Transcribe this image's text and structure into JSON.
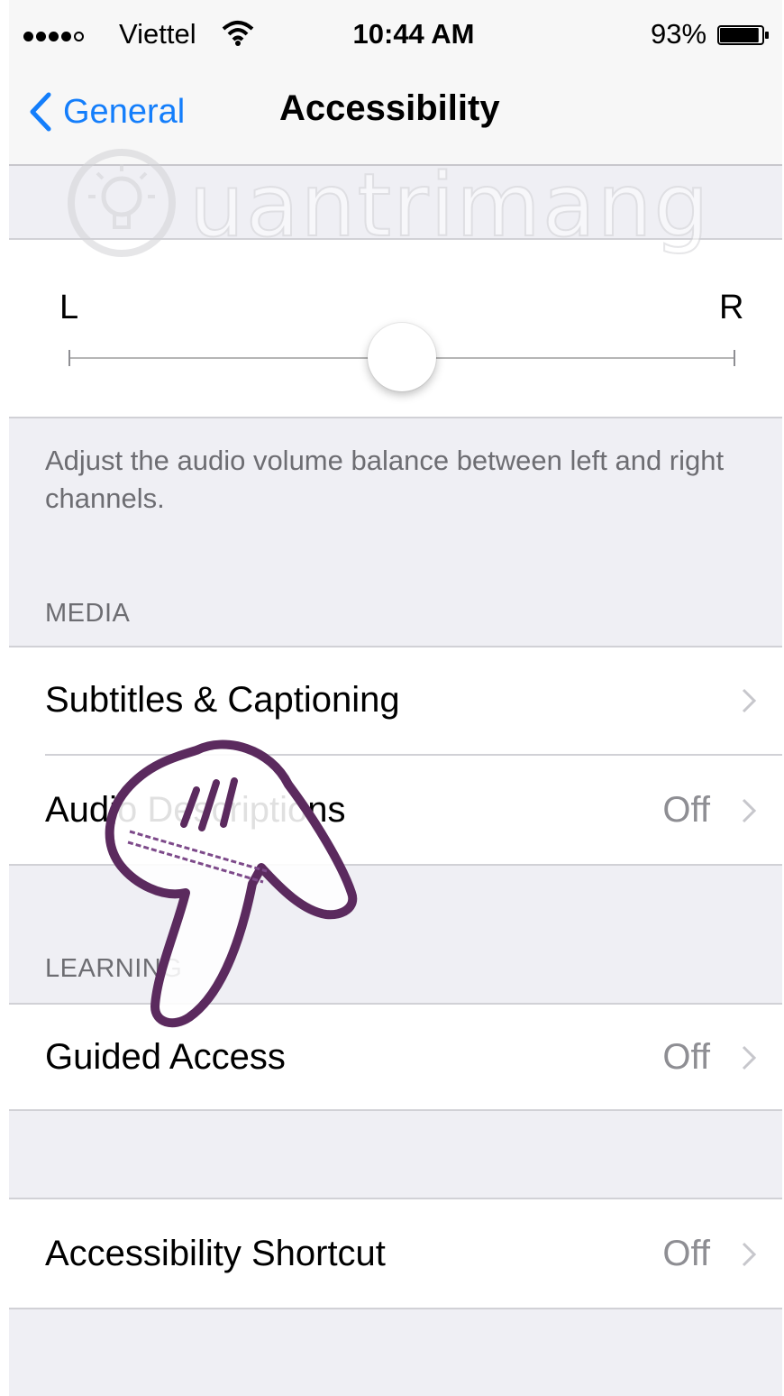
{
  "status_bar": {
    "carrier": "Viettel",
    "time": "10:44 AM",
    "battery_percent": "93%",
    "battery_level": 0.93,
    "signal_bars": 4,
    "icons": [
      "signal-dots-icon",
      "wifi-icon",
      "battery-icon"
    ]
  },
  "nav": {
    "back_label": "General",
    "title": "Accessibility",
    "back_icon": "chevron-left-icon"
  },
  "balance": {
    "left_label": "L",
    "right_label": "R",
    "value": 0.5,
    "footer": "Adjust the audio volume balance between left and right channels."
  },
  "media_section": {
    "header": "MEDIA",
    "items": [
      {
        "label": "Subtitles & Captioning",
        "value": ""
      },
      {
        "label": "Audio Descriptions",
        "value": "Off"
      }
    ]
  },
  "learning_section": {
    "header": "LEARNING",
    "items": [
      {
        "label": "Guided Access",
        "value": "Off"
      }
    ]
  },
  "shortcut_section": {
    "items": [
      {
        "label": "Accessibility Shortcut",
        "value": "Off"
      }
    ]
  },
  "watermark": {
    "text": "uantrimang",
    "icon": "lightbulb-logo-icon"
  },
  "colors": {
    "accent": "#147efb",
    "background": "#efeff4",
    "secondary_text": "#8e8e93",
    "annotation": "#5b2a5e"
  },
  "overlay_icon": "pointing-hand-icon"
}
